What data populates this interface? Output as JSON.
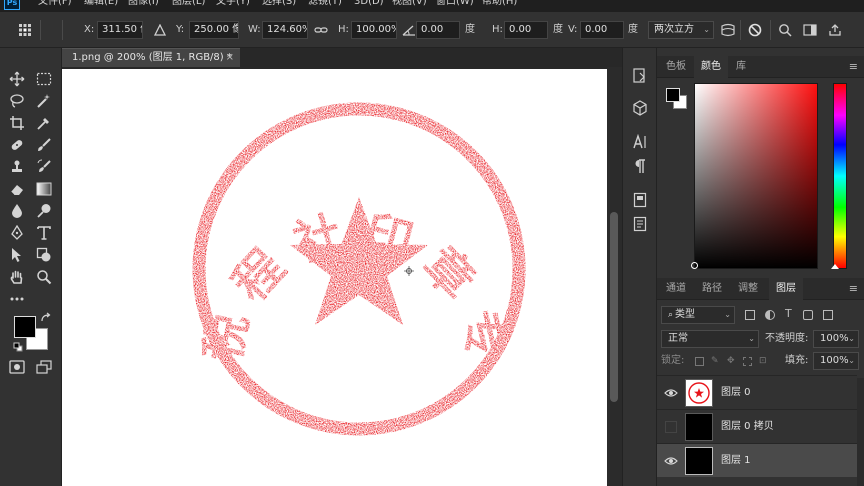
{
  "menu": [
    "文件(F)",
    "编辑(E)",
    "图像(I)",
    "图层(L)",
    "文字(Y)",
    "选择(S)",
    "滤镜(T)",
    "3D(D)",
    "视图(V)",
    "窗口(W)",
    "帮助(H)"
  ],
  "app_logo": "Ps",
  "options": {
    "x_label": "X:",
    "x_value": "311.50 像素",
    "y_label": "Y:",
    "y_value": "250.00 像素",
    "w_label": "W:",
    "w_value": "124.60%",
    "h_label": "H:",
    "h_value": "100.00%",
    "angle_value": "0.00",
    "angle_unit": "度",
    "skew_h_label": "H:",
    "skew_h_value": "0.00",
    "skew_h_unit": "度",
    "skew_v_label": "V:",
    "skew_v_value": "0.00",
    "skew_v_unit": "度",
    "interpolation": "两次立方"
  },
  "document": {
    "tab_title": "1.png @ 200% (图层 1, RGB/8) *",
    "close_glyph": "×"
  },
  "stamp": {
    "text_chars": [
      "税",
      "程",
      "社",
      "印",
      "章",
      "专",
      "用"
    ],
    "color": "#e8141a"
  },
  "panels": {
    "color_tabs": [
      "色板",
      "颜色",
      "库"
    ],
    "color_active": "颜色",
    "layers_tabs": [
      "通道",
      "路径",
      "调整",
      "图层"
    ],
    "layers_active": "图层",
    "filter_label": "类型",
    "blend_mode": "正常",
    "opacity_label": "不透明度:",
    "opacity_value": "100%",
    "lock_label": "锁定:",
    "fill_label": "填充:",
    "fill_value": "100%",
    "menu_glyph": "≡"
  },
  "layers": [
    {
      "name": "图层 0",
      "visible": true,
      "thumb": "stamp",
      "selected": false
    },
    {
      "name": "图层 0 拷贝",
      "visible": false,
      "thumb": "black",
      "selected": false
    },
    {
      "name": "图层 1",
      "visible": true,
      "thumb": "black",
      "selected": true
    }
  ],
  "icons": {
    "tool_icons": [
      "move-icon",
      "marquee-icon",
      "lasso-icon",
      "magic-wand-icon",
      "crop-icon",
      "eyedropper-icon",
      "healing-brush-icon",
      "brush-icon",
      "clone-stamp-icon",
      "history-brush-icon",
      "eraser-icon",
      "gradient-icon",
      "blur-icon",
      "dodge-icon",
      "pen-icon",
      "type-icon",
      "path-selection-icon",
      "shape-icon",
      "hand-icon",
      "zoom-icon",
      "more-tools-icon"
    ]
  },
  "colors": {
    "stamp_red": "#e8141a",
    "panel_bg": "#323232",
    "canvas_bg": "#282828",
    "foreground": "#000000",
    "background": "#ffffff"
  }
}
